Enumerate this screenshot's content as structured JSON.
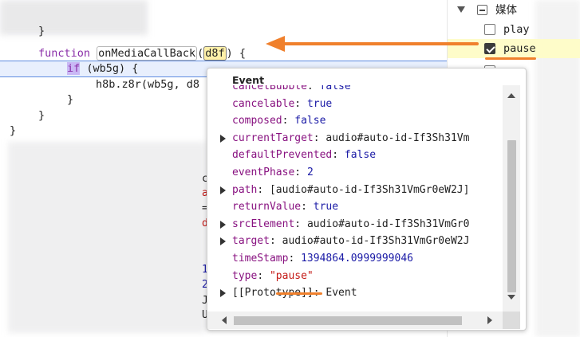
{
  "editor": {
    "line_brace_top": "}",
    "fn_keyword": "function",
    "fn_name": "onMediaCallBack",
    "fn_paren_open": "(",
    "fn_param": "d8f",
    "fn_paren_close": ") {",
    "if_keyword": "if",
    "if_cond": " (wb5g) {",
    "call_line": "h8b.z8r(wb5g, d8",
    "close_inner": "}",
    "close_fn": "}",
    "close_outer": "}",
    "bg_fragments": [
      "c",
      "a",
      "=",
      "d",
      "1",
      "2",
      "J",
      "U"
    ]
  },
  "event_popover": {
    "title": "Event",
    "properties": [
      {
        "key": "cancelBubble",
        "value": "false",
        "vtype": "bool",
        "expandable": false
      },
      {
        "key": "cancelable",
        "value": "true",
        "vtype": "bool",
        "expandable": false
      },
      {
        "key": "composed",
        "value": "false",
        "vtype": "bool",
        "expandable": false
      },
      {
        "key": "currentTarget",
        "value": "audio#auto-id-If3Sh31Vm",
        "vtype": "dom",
        "expandable": true
      },
      {
        "key": "defaultPrevented",
        "value": "false",
        "vtype": "bool",
        "expandable": false
      },
      {
        "key": "eventPhase",
        "value": "2",
        "vtype": "bool",
        "expandable": false
      },
      {
        "key": "path",
        "value": "[audio#auto-id-If3Sh31VmGr0eW2J]",
        "vtype": "dom",
        "expandable": true
      },
      {
        "key": "returnValue",
        "value": "true",
        "vtype": "bool",
        "expandable": false
      },
      {
        "key": "srcElement",
        "value": "audio#auto-id-If3Sh31VmGr0",
        "vtype": "dom",
        "expandable": true
      },
      {
        "key": "target",
        "value": "audio#auto-id-If3Sh31VmGr0eW2J",
        "vtype": "dom",
        "expandable": true
      },
      {
        "key": "timeStamp",
        "value": "1394864.0999999046",
        "vtype": "bool",
        "expandable": false
      },
      {
        "key": "type",
        "value": "\"pause\"",
        "vtype": "string",
        "expandable": false
      },
      {
        "key": "[[Prototype]]",
        "value": "Event",
        "vtype": "dom",
        "expandable": true,
        "proto": true
      }
    ]
  },
  "listeners": {
    "category": "媒体",
    "items": [
      {
        "label": "play",
        "checked": false
      },
      {
        "label": "pause",
        "checked": true
      }
    ]
  },
  "colors": {
    "annotation": "#f0802c",
    "selected_row": "#fefcc9"
  },
  "icons": [
    "expand-triangle-icon",
    "collapse-box-icon",
    "checkbox-icon",
    "arrow-annotation"
  ]
}
